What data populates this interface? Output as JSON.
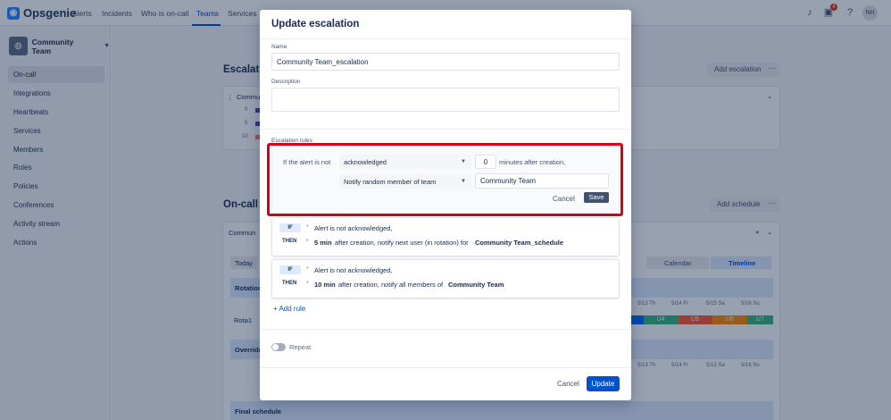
{
  "nav": {
    "logo": "Opsgenie",
    "items": [
      "Alerts",
      "Incidents",
      "Who is on-call",
      "Teams",
      "Services"
    ],
    "notification_count": "4",
    "avatar_initials": "NH"
  },
  "sidebar": {
    "team_name": "Community Team",
    "items": [
      "On-call",
      "Integrations",
      "Heartbeats",
      "Services",
      "Members",
      "Roles",
      "Policies",
      "Conferences",
      "Activity stream",
      "Actions"
    ]
  },
  "background": {
    "escalation_title": "Escalation",
    "add_escalation": "Add escalation",
    "community_label": "Commu",
    "rows": [
      "0",
      "5",
      "10"
    ],
    "oncall_title": "On-call s",
    "add_schedule": "Add schedule",
    "schedule_label": "Commun",
    "today": "Today",
    "rotation": "Rotation",
    "rota1": "Rota1",
    "overrides": "Override",
    "final_schedule": "Final schedule",
    "calendar": "Calendar",
    "timeline": "Timeline",
    "days": [
      "5/13 Th",
      "5/14 Fr",
      "5/15 Sa",
      "5/16 Su"
    ],
    "users": [
      "U4",
      "U5",
      "U6",
      "U7"
    ]
  },
  "modal": {
    "title": "Update escalation",
    "name_label": "Name",
    "name_value": "Community Team_escalation",
    "description_label": "Description",
    "description_value": "",
    "rules_label": "Escalation rules",
    "editing_rule": {
      "prefix": "If the alert is not",
      "condition": "acknowledged",
      "minutes": "0",
      "suffix": "minutes after creation,",
      "action": "Notify random member of team",
      "target": "Community Team",
      "cancel": "Cancel",
      "save": "Save"
    },
    "rules": [
      {
        "if_tag": "IF",
        "if_text": "Alert is not acknowledged,",
        "then_tag": "THEN",
        "minutes": "5 min",
        "then_text": "after creation, notify next user (in rotation) for",
        "target": "Community Team_schedule"
      },
      {
        "if_tag": "IF",
        "if_text": "Alert is not acknowledged,",
        "then_tag": "THEN",
        "minutes": "10 min",
        "then_text": "after creation, notify all members of",
        "target": "Community Team"
      }
    ],
    "add_rule": "+ Add rule",
    "repeat": "Repeat",
    "cancel": "Cancel",
    "update": "Update"
  }
}
